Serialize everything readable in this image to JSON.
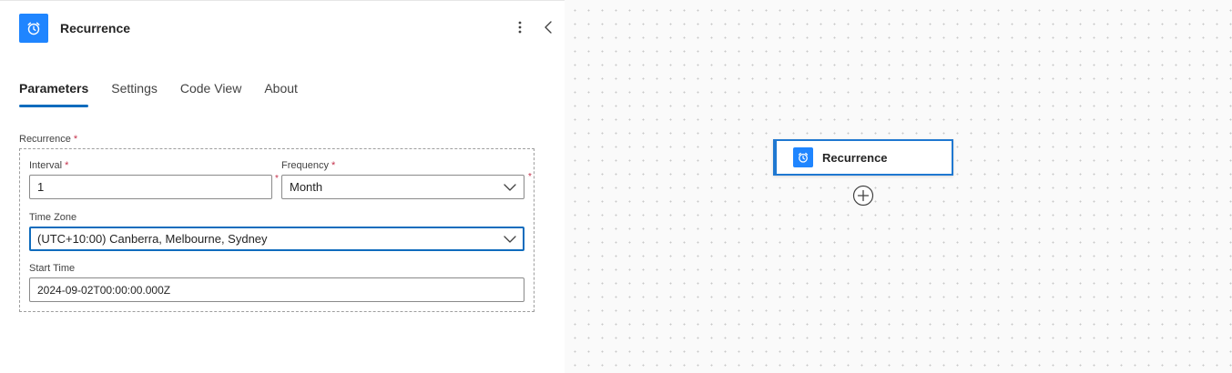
{
  "panel": {
    "title": "Recurrence",
    "icon": "alarm-clock-icon",
    "accent_color": "#1f85ff",
    "tabs": [
      {
        "label": "Parameters",
        "active": true
      },
      {
        "label": "Settings",
        "active": false
      },
      {
        "label": "Code View",
        "active": false
      },
      {
        "label": "About",
        "active": false
      }
    ]
  },
  "form": {
    "section_label": "Recurrence",
    "required_mark": "*",
    "interval": {
      "label": "Interval",
      "value": "1"
    },
    "frequency": {
      "label": "Frequency",
      "value": "Month"
    },
    "time_zone": {
      "label": "Time Zone",
      "value": "(UTC+10:00) Canberra, Melbourne, Sydney"
    },
    "start_time": {
      "label": "Start Time",
      "value": "2024-09-02T00:00:00.000Z"
    }
  },
  "canvas": {
    "node": {
      "title": "Recurrence",
      "icon": "alarm-clock-icon"
    },
    "add_step_icon": "plus-circle-icon"
  }
}
